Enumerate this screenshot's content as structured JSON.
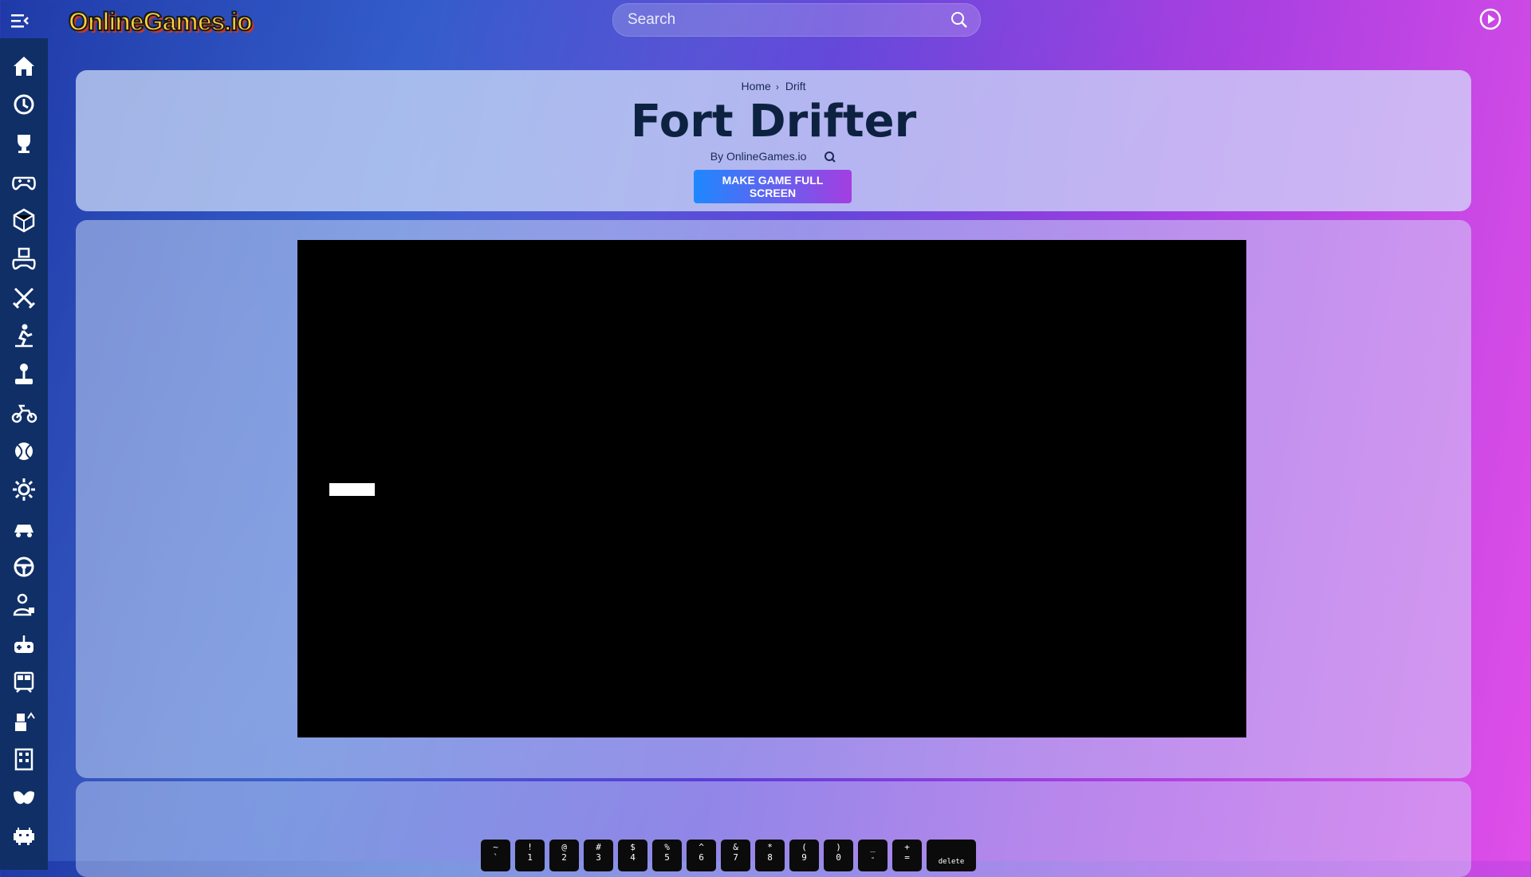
{
  "site": {
    "logo_text": "OnlineGames.io"
  },
  "search": {
    "placeholder": "Search"
  },
  "sidebar": {
    "items": [
      {
        "icon": "home-icon"
      },
      {
        "icon": "history-icon"
      },
      {
        "icon": "trophy-icon"
      },
      {
        "icon": "gamepad-icon"
      },
      {
        "icon": "dice-icon"
      },
      {
        "icon": "cube-gamepad-icon"
      },
      {
        "icon": "swords-icon"
      },
      {
        "icon": "skater-icon"
      },
      {
        "icon": "joystick-icon"
      },
      {
        "icon": "motorbike-icon"
      },
      {
        "icon": "ball-icon"
      },
      {
        "icon": "gear-icon"
      },
      {
        "icon": "car-icon"
      },
      {
        "icon": "steering-wheel-icon"
      },
      {
        "icon": "puzzle-person-icon"
      },
      {
        "icon": "controller-plus-icon"
      },
      {
        "icon": "train-icon"
      },
      {
        "icon": "robot-icon"
      },
      {
        "icon": "building-icon"
      },
      {
        "icon": "mask-icon"
      },
      {
        "icon": "space-invader-icon"
      }
    ]
  },
  "breadcrumb": {
    "home": "Home",
    "category": "Drift"
  },
  "game": {
    "title": "Fort Drifter",
    "byline": "By OnlineGames.io"
  },
  "buttons": {
    "fullscreen": "MAKE GAME FULL SCREEN"
  },
  "keyboard": {
    "keys": [
      {
        "top": "~",
        "bottom": "`"
      },
      {
        "top": "!",
        "bottom": "1"
      },
      {
        "top": "@",
        "bottom": "2"
      },
      {
        "top": "#",
        "bottom": "3"
      },
      {
        "top": "$",
        "bottom": "4"
      },
      {
        "top": "%",
        "bottom": "5"
      },
      {
        "top": "^",
        "bottom": "6"
      },
      {
        "top": "&",
        "bottom": "7"
      },
      {
        "top": "*",
        "bottom": "8"
      },
      {
        "top": "(",
        "bottom": "9"
      },
      {
        "top": ")",
        "bottom": "0"
      },
      {
        "top": "_",
        "bottom": "-"
      },
      {
        "top": "+",
        "bottom": "="
      }
    ],
    "delete_label": "delete"
  }
}
